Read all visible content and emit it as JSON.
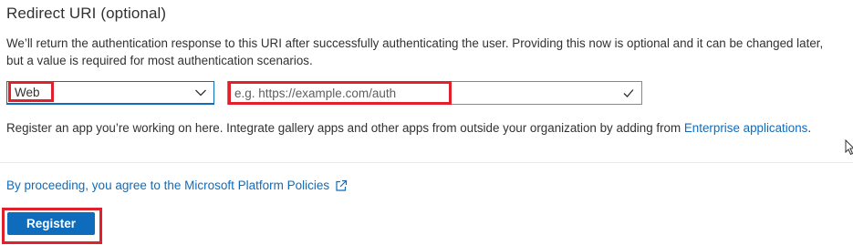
{
  "section": {
    "title": "Redirect URI (optional)",
    "description": "We’ll return the authentication response to this URI after successfully authenticating the user. Providing this now is optional and it can be changed later, but a value is required for most authentication scenarios."
  },
  "platform_select": {
    "value": "Web",
    "icon": "chevron-down-icon"
  },
  "redirect_uri": {
    "value": "",
    "placeholder": "e.g. https://example.com/auth",
    "icon": "checkmark-icon"
  },
  "register_info": {
    "text": "Register an app you’re working on here. Integrate gallery apps and other apps from outside your organization by adding from ",
    "link_text": "Enterprise applications",
    "suffix": "."
  },
  "policies": {
    "link_text": "By proceeding, you agree to the Microsoft Platform Policies",
    "icon": "external-link-icon"
  },
  "register_button": {
    "label": "Register"
  },
  "colors": {
    "accent": "#0f6cbd",
    "highlight": "#e0202a",
    "text": "#323130"
  }
}
